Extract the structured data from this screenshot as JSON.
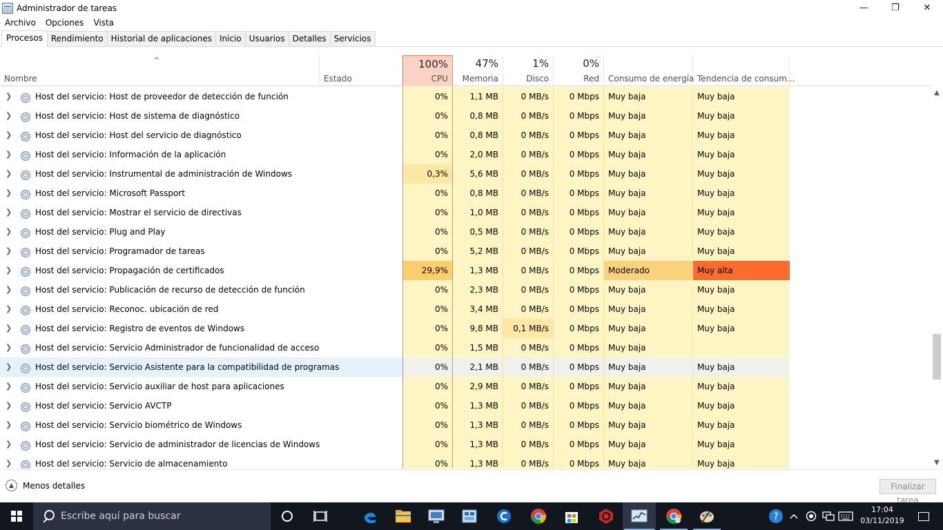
{
  "window": {
    "title": "Administrador de tareas",
    "minimize": "—",
    "maximize": "❐",
    "close": "✕"
  },
  "menu": [
    "Archivo",
    "Opciones",
    "Vista"
  ],
  "tabs": [
    "Procesos",
    "Rendimiento",
    "Historial de aplicaciones",
    "Inicio",
    "Usuarios",
    "Detalles",
    "Servicios"
  ],
  "header": {
    "sort_indicator": "^",
    "name": "Nombre",
    "status": "Estado",
    "cpu_pct": "100%",
    "cpu": "CPU",
    "mem_pct": "47%",
    "mem": "Memoria",
    "disk_pct": "1%",
    "disk": "Disco",
    "net_pct": "0%",
    "net": "Red",
    "power": "Consumo de energía",
    "trend": "Tendencia de consum..."
  },
  "colors": {
    "cpu_header": "#fbd3c4",
    "cell_low": "#fff4c4",
    "cell_mild": "#fde8a6",
    "cell_high": "#fccd6c",
    "power_moderate": "#fdd27c",
    "trend_very_high": "#fa6d2e",
    "selected_row": "#e5f1fb"
  },
  "rows": [
    {
      "name": "Host del servicio: Host de proveedor de detección de función",
      "cpu": "0%",
      "mem": "1,1 MB",
      "disk": "0 MB/s",
      "net": "0 Mbps",
      "power": "Muy baja",
      "trend": "Muy baja"
    },
    {
      "name": "Host del servicio: Host de sistema de diagnóstico",
      "cpu": "0%",
      "mem": "0,8 MB",
      "disk": "0 MB/s",
      "net": "0 Mbps",
      "power": "Muy baja",
      "trend": "Muy baja"
    },
    {
      "name": "Host del servicio: Host del servicio de diagnóstico",
      "cpu": "0%",
      "mem": "0,8 MB",
      "disk": "0 MB/s",
      "net": "0 Mbps",
      "power": "Muy baja",
      "trend": "Muy baja"
    },
    {
      "name": "Host del servicio: Información de la aplicación",
      "cpu": "0%",
      "mem": "2,0 MB",
      "disk": "0 MB/s",
      "net": "0 Mbps",
      "power": "Muy baja",
      "trend": "Muy baja"
    },
    {
      "name": "Host del servicio: Instrumental de administración de Windows",
      "cpu": "0,3%",
      "mem": "5,6 MB",
      "disk": "0 MB/s",
      "net": "0 Mbps",
      "power": "Muy baja",
      "trend": "Muy baja"
    },
    {
      "name": "Host del servicio: Microsoft Passport",
      "cpu": "0%",
      "mem": "0,8 MB",
      "disk": "0 MB/s",
      "net": "0 Mbps",
      "power": "Muy baja",
      "trend": "Muy baja"
    },
    {
      "name": "Host del servicio: Mostrar el servicio de directivas",
      "cpu": "0%",
      "mem": "1,0 MB",
      "disk": "0 MB/s",
      "net": "0 Mbps",
      "power": "Muy baja",
      "trend": "Muy baja"
    },
    {
      "name": "Host del servicio: Plug and Play",
      "cpu": "0%",
      "mem": "0,5 MB",
      "disk": "0 MB/s",
      "net": "0 Mbps",
      "power": "Muy baja",
      "trend": "Muy baja"
    },
    {
      "name": "Host del servicio: Programador de tareas",
      "cpu": "0%",
      "mem": "5,2 MB",
      "disk": "0 MB/s",
      "net": "0 Mbps",
      "power": "Muy baja",
      "trend": "Muy baja"
    },
    {
      "name": "Host del servicio: Propagación de certificados",
      "cpu": "29,9%",
      "mem": "1,3 MB",
      "disk": "0 MB/s",
      "net": "0 Mbps",
      "power": "Moderado",
      "trend": "Muy alta"
    },
    {
      "name": "Host del servicio: Publicación de recurso de detección de función",
      "cpu": "0%",
      "mem": "2,3 MB",
      "disk": "0 MB/s",
      "net": "0 Mbps",
      "power": "Muy baja",
      "trend": "Muy baja"
    },
    {
      "name": "Host del servicio: Reconoc. ubicación de red",
      "cpu": "0%",
      "mem": "3,4 MB",
      "disk": "0 MB/s",
      "net": "0 Mbps",
      "power": "Muy baja",
      "trend": "Muy baja"
    },
    {
      "name": "Host del servicio: Registro de eventos de Windows",
      "cpu": "0%",
      "mem": "9,8 MB",
      "disk": "0,1 MB/s",
      "net": "0 Mbps",
      "power": "Muy baja",
      "trend": "Muy baja"
    },
    {
      "name": "Host del servicio: Servicio Administrador de funcionalidad de acceso",
      "cpu": "0%",
      "mem": "1,5 MB",
      "disk": "0 MB/s",
      "net": "0 Mbps",
      "power": "Muy baja",
      "trend": ""
    },
    {
      "name": "Host del servicio: Servicio Asistente para la compatibilidad de programas",
      "cpu": "0%",
      "mem": "2,1 MB",
      "disk": "0 MB/s",
      "net": "0 Mbps",
      "power": "Muy baja",
      "trend": "Muy baja"
    },
    {
      "name": "Host del servicio: Servicio auxiliar de host para aplicaciones",
      "cpu": "0%",
      "mem": "2,9 MB",
      "disk": "0 MB/s",
      "net": "0 Mbps",
      "power": "Muy baja",
      "trend": "Muy baja"
    },
    {
      "name": "Host del servicio: Servicio AVCTP",
      "cpu": "0%",
      "mem": "1,3 MB",
      "disk": "0 MB/s",
      "net": "0 Mbps",
      "power": "Muy baja",
      "trend": "Muy baja"
    },
    {
      "name": "Host del servicio: Servicio biométrico de Windows",
      "cpu": "0%",
      "mem": "1,3 MB",
      "disk": "0 MB/s",
      "net": "0 Mbps",
      "power": "Muy baja",
      "trend": "Muy baja"
    },
    {
      "name": "Host del servicio: Servicio de administrador de licencias de Windows",
      "cpu": "0%",
      "mem": "1,3 MB",
      "disk": "0 MB/s",
      "net": "0 Mbps",
      "power": "Muy baja",
      "trend": "Muy baja"
    },
    {
      "name": "Host del servicio: Servicio de almacenamiento",
      "cpu": "0%",
      "mem": "1,3 MB",
      "disk": "0 MB/s",
      "net": "0 Mbps",
      "power": "Muy baja",
      "trend": "Muy baja"
    }
  ],
  "footer": {
    "less_details": "Menos detalles",
    "end_task": "Finalizar tarea"
  },
  "taskbar": {
    "search_placeholder": "Escribe aquí para buscar",
    "apps": [
      "task-view",
      "edge",
      "file-explorer",
      "network-app",
      "calculator-app",
      "ccleaner",
      "chrome",
      "microsoft-store",
      "antivirus",
      "task-manager",
      "chrome-profile",
      "paint-app"
    ],
    "time": "17:04",
    "date": "03/11/2019"
  }
}
